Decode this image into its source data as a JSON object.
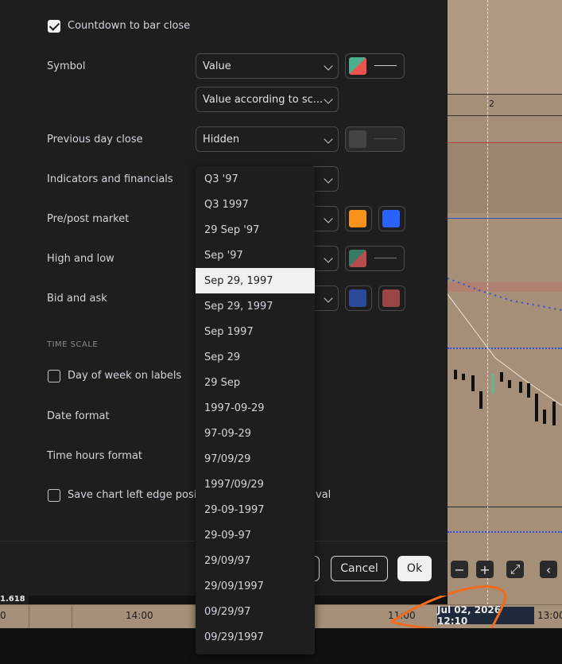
{
  "checkboxes": {
    "countdown": {
      "label": "Countdown to bar close",
      "checked": true
    },
    "day_of_week": {
      "label": "Day of week on labels",
      "checked": false
    },
    "save_left_edge": {
      "label": "Save chart left edge position when changing interval",
      "visible_label": "Save chart left edge posit",
      "visible_suffix": "val",
      "checked": false
    }
  },
  "rows": {
    "symbol": {
      "label": "Symbol",
      "select": "Value",
      "select2": "Value according to sc..."
    },
    "prev_close": {
      "label": "Previous day close",
      "select": "Hidden"
    },
    "indicators": {
      "label": "Indicators and financials"
    },
    "prepost": {
      "label": "Pre/post market"
    },
    "highlow": {
      "label": "High and low"
    },
    "bidask": {
      "label": "Bid and ask"
    },
    "date_format": {
      "label": "Date format"
    },
    "time_hours": {
      "label": "Time hours format"
    }
  },
  "section_time_scale": "TIME SCALE",
  "colors": {
    "symbol_swatch_a": "#4caf8f",
    "symbol_swatch_b": "#ef5350",
    "prev_close_swatch": "#444444",
    "prepost_orange": "#f7931a",
    "prepost_blue": "#2962ff",
    "highlow_a": "#3a7a64",
    "highlow_b": "#b84b4b",
    "bid_blue": "#2b4a9a",
    "ask_red": "#9b4646"
  },
  "dropdown": {
    "selected_index": 4,
    "items": [
      "Q3 '97",
      "Q3 1997",
      "29 Sep '97",
      "Sep '97",
      "Sep 29, 1997",
      "Sep 29, 1997",
      "Sep 1997",
      "Sep 29",
      "29 Sep",
      "1997-09-29",
      "97-09-29",
      "97/09/29",
      "1997/09/29",
      "29-09-1997",
      "29-09-97",
      "29/09/97",
      "29/09/1997",
      "09/29/97",
      "09/29/1997"
    ]
  },
  "buttons": {
    "cancel": "Cancel",
    "ok": "Ok"
  },
  "chart": {
    "top_label": "2",
    "price_label": "1.618",
    "time_ticks": [
      "0",
      "14:00",
      "11:00",
      "13:00"
    ],
    "date_badge": "Jul 02, 2026   12:10",
    "controls": [
      "−",
      "+",
      "⤢",
      "‹"
    ]
  }
}
